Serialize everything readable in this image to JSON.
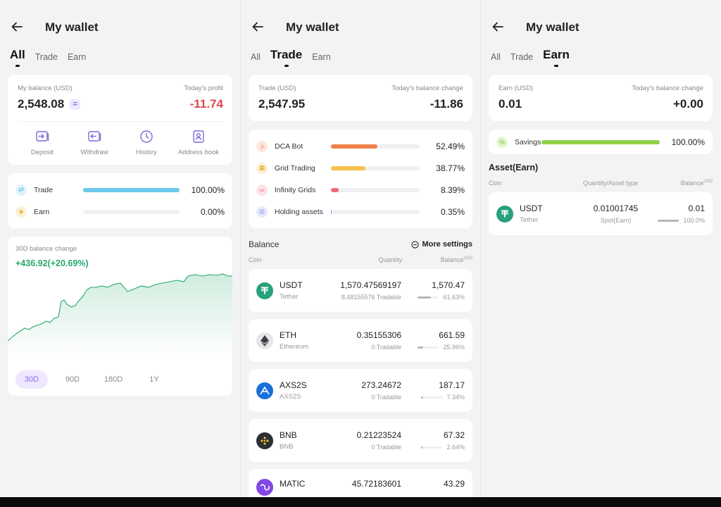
{
  "colors": {
    "accent": "#8f6af2",
    "green": "#27a76c",
    "red": "#e0454f"
  },
  "screen1": {
    "title": "My wallet",
    "tabs": [
      "All",
      "Trade",
      "Earn"
    ],
    "balance_label": "My balance (USD)",
    "balance_value": "2,548.08",
    "profit_label": "Today's profit",
    "profit_value": "-11.74",
    "actions": [
      {
        "label": "Deposit",
        "icon": "deposit-icon"
      },
      {
        "label": "Withdraw",
        "icon": "withdraw-icon"
      },
      {
        "label": "History",
        "icon": "clock-icon"
      },
      {
        "label": "Address book",
        "icon": "address-book-icon"
      }
    ],
    "allocation": [
      {
        "name": "Trade",
        "percent": "100.00%",
        "fill": 100,
        "color": "#6cc9ea"
      },
      {
        "name": "Earn",
        "percent": "0.00%",
        "fill": 0,
        "color": "#f5c24a"
      }
    ],
    "change_label": "30D balance change",
    "change_value": "+436.92(+20.69%)",
    "ranges": [
      "30D",
      "90D",
      "180D",
      "1Y"
    ]
  },
  "screen2": {
    "title": "My wallet",
    "tabs": [
      "All",
      "Trade",
      "Earn"
    ],
    "balance_label": "Trade (USD)",
    "balance_value": "2,547.95",
    "change_label": "Today's balance change",
    "change_value": "-11.86",
    "allocation": [
      {
        "name": "DCA Bot",
        "percent": "52.49%",
        "fill": 52.49,
        "color": "#f0804a"
      },
      {
        "name": "Grid Trading",
        "percent": "38.77%",
        "fill": 38.77,
        "color": "#f5c24a"
      },
      {
        "name": "Infinity Grids",
        "percent": "8.39%",
        "fill": 8.39,
        "color": "#f06a7a"
      },
      {
        "name": "Holding assets",
        "percent": "0.35%",
        "fill": 0.35,
        "color": "#8f9cf2"
      }
    ],
    "section_title": "Balance",
    "more_settings": "More settings",
    "columns": [
      "Coin",
      "Quantity",
      "Balance"
    ],
    "column_unit": "USD",
    "coins": [
      {
        "symbol": "USDT",
        "name": "Tether",
        "quantity": "1,570.47569197",
        "tradable": "8.48155576 Tradable",
        "balance": "1,570.47",
        "share": "61.63%",
        "fill": 61.63
      },
      {
        "symbol": "ETH",
        "name": "Ethereum",
        "quantity": "0.35155306",
        "tradable": "0 Tradable",
        "balance": "661.59",
        "share": "25.96%",
        "fill": 25.96
      },
      {
        "symbol": "AXS2S",
        "name": "AXS2S",
        "quantity": "273.24672",
        "tradable": "0 Tradable",
        "balance": "187.17",
        "share": "7.34%",
        "fill": 7.34
      },
      {
        "symbol": "BNB",
        "name": "BNB",
        "quantity": "0.21223524",
        "tradable": "0 Tradable",
        "balance": "67.32",
        "share": "2.64%",
        "fill": 2.64
      },
      {
        "symbol": "MATIC",
        "name": "",
        "quantity": "45.72183601",
        "tradable": "",
        "balance": "43.29",
        "share": "",
        "fill": 0
      }
    ]
  },
  "screen3": {
    "title": "My wallet",
    "tabs": [
      "All",
      "Trade",
      "Earn"
    ],
    "balance_label": "Earn (USD)",
    "balance_value": "0.01",
    "change_label": "Today's balance change",
    "change_value": "+0.00",
    "allocation": [
      {
        "name": "Savings",
        "percent": "100.00%",
        "fill": 100,
        "color": "#8fd14a"
      }
    ],
    "asset_title": "Asset(Earn)",
    "columns": [
      "Coin",
      "Quantity/Asset type",
      "Balance"
    ],
    "column_unit": "USD",
    "coins": [
      {
        "symbol": "USDT",
        "name": "Tether",
        "quantity": "0.01001745",
        "type": "Spot(Earn)",
        "balance": "0.01",
        "share": "100.0%",
        "fill": 100
      }
    ]
  }
}
